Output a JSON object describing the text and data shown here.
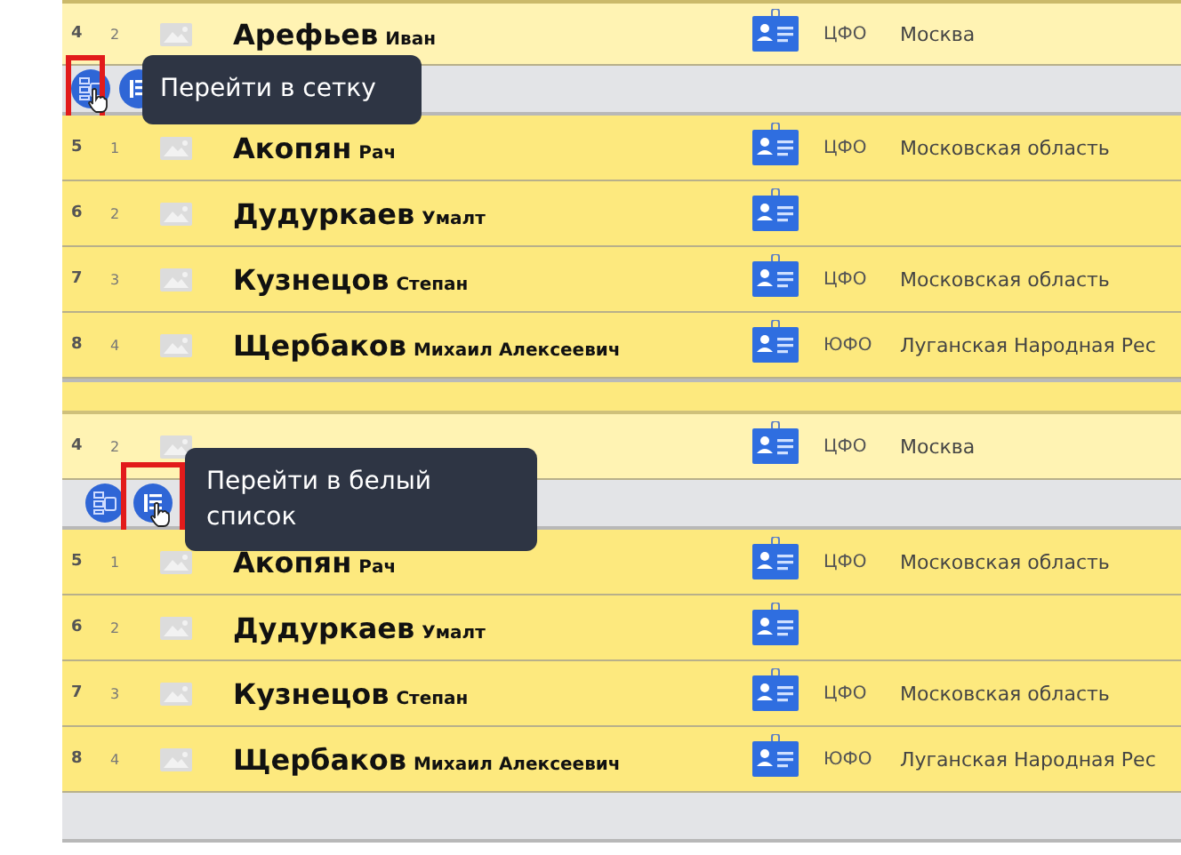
{
  "panels": [
    {
      "rows": [
        {
          "kind": "person",
          "index": "4",
          "sub": "2",
          "surname": "Арефьев",
          "given": "Иван",
          "district": "ЦФО",
          "region": "Москва",
          "highlighted": true
        },
        {
          "kind": "group",
          "buttons": [
            {
              "kind": "grid",
              "hovered": true
            },
            {
              "kind": "list",
              "hovered": false
            }
          ],
          "tooltip": "Перейти в сетку"
        },
        {
          "kind": "person",
          "index": "5",
          "sub": "1",
          "surname": "Акопян",
          "given": "Рач",
          "district": "ЦФО",
          "region": "Московская область",
          "highlighted": false
        },
        {
          "kind": "person",
          "index": "6",
          "sub": "2",
          "surname": "Дудуркаев",
          "given": "Умалт",
          "highlighted": false
        },
        {
          "kind": "person",
          "index": "7",
          "sub": "3",
          "surname": "Кузнецов",
          "given": "Степан",
          "district": "ЦФО",
          "region": "Московская область",
          "highlighted": false
        },
        {
          "kind": "person",
          "index": "8",
          "sub": "4",
          "surname": "Щербаков",
          "given": "Михаил Алексеевич",
          "district": "ЮФО",
          "region": "Луганская Народная Рес",
          "highlighted": false
        }
      ]
    },
    {
      "rows": [
        {
          "kind": "person",
          "index": "4",
          "sub": "2",
          "district": "ЦФО",
          "region": "Москва",
          "highlighted": true
        },
        {
          "kind": "group",
          "buttons": [
            {
              "kind": "grid",
              "hovered": false
            },
            {
              "kind": "list",
              "hovered": true
            }
          ],
          "tooltip": "Перейти в белый список"
        },
        {
          "kind": "person",
          "index": "5",
          "sub": "1",
          "surname": "Акопян",
          "given": "Рач",
          "district": "ЦФО",
          "region": "Московская область",
          "highlighted": false
        },
        {
          "kind": "person",
          "index": "6",
          "sub": "2",
          "surname": "Дудуркаев",
          "given": "Умалт",
          "highlighted": false
        },
        {
          "kind": "person",
          "index": "7",
          "sub": "3",
          "surname": "Кузнецов",
          "given": "Степан",
          "district": "ЦФО",
          "region": "Московская область",
          "highlighted": false
        },
        {
          "kind": "person",
          "index": "8",
          "sub": "4",
          "surname": "Щербаков",
          "given": "Михаил Алексеевич",
          "district": "ЮФО",
          "region": "Луганская Народная Рес",
          "highlighted": false
        },
        {
          "kind": "group",
          "buttons": []
        }
      ]
    }
  ]
}
